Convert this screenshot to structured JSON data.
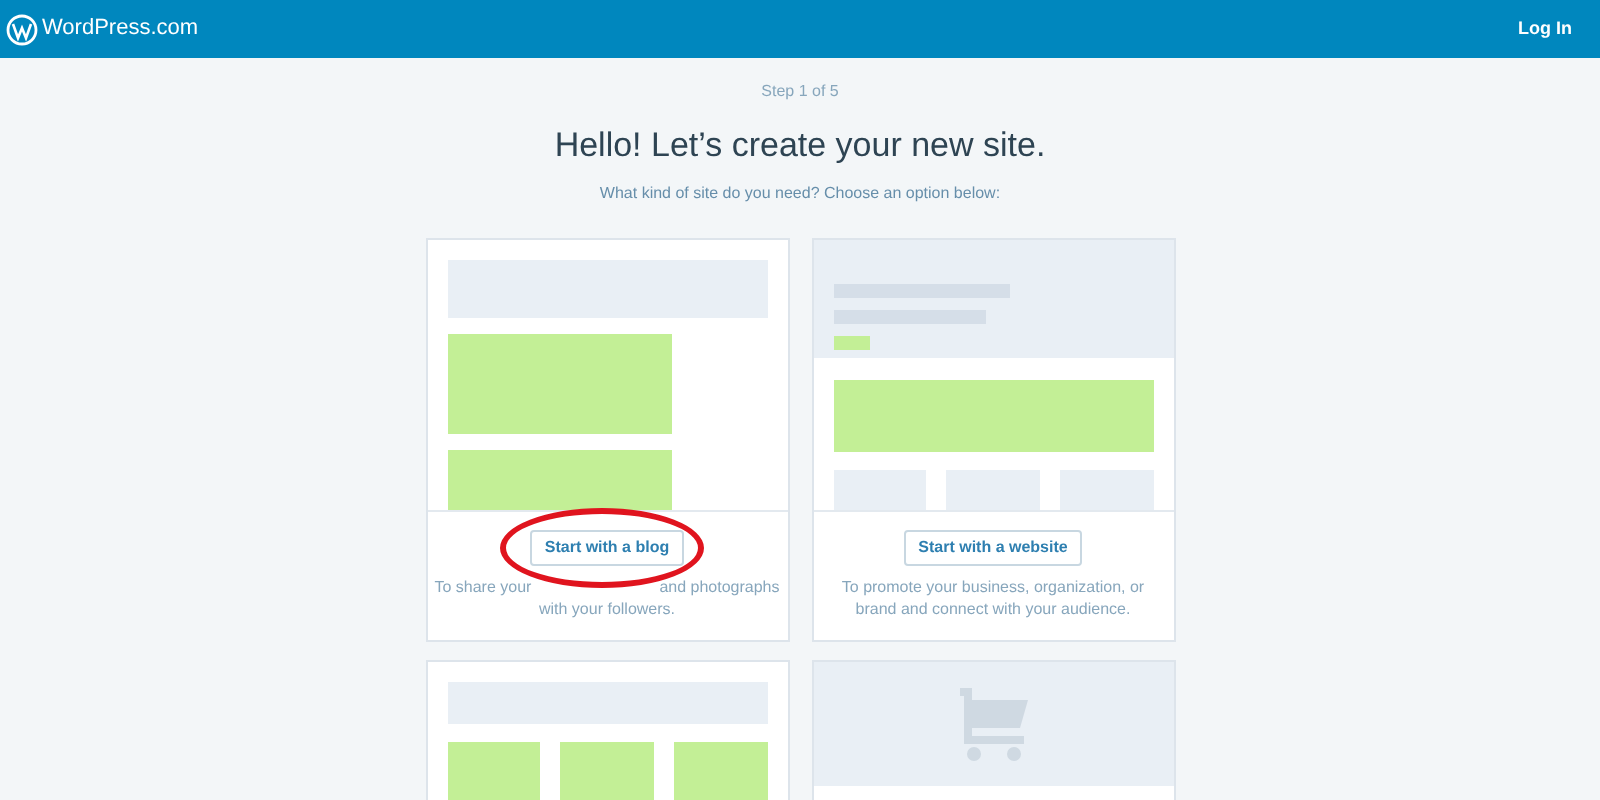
{
  "header": {
    "brand": "WordPress.com",
    "login": "Log In"
  },
  "step": "Step 1 of 5",
  "title": "Hello! Let’s create your new site.",
  "subtitle": "What kind of site do you need? Choose an option below:",
  "cards": [
    {
      "kind": "blog",
      "button": "Start with a blog",
      "description": [
        "To share your",
        "and photographs",
        "with your followers."
      ],
      "highlighted": true
    },
    {
      "kind": "website",
      "button": "Start with a website",
      "description": [
        "To promote your business, organization, or",
        "brand and connect with your audience."
      ],
      "highlighted": false
    },
    {
      "kind": "grid"
    },
    {
      "kind": "store"
    }
  ]
}
